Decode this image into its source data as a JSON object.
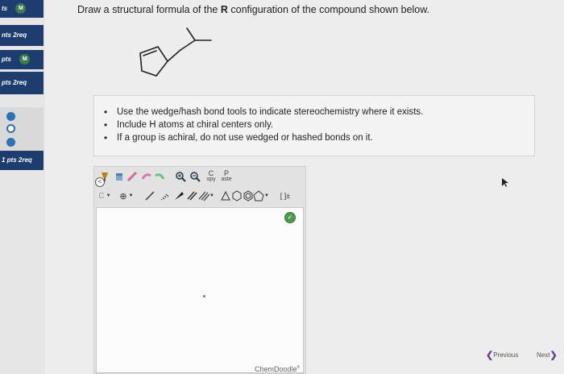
{
  "sidebar": {
    "rows": [
      {
        "label": "ts",
        "badge": "M"
      },
      {
        "label": "nts  2req"
      },
      {
        "label": "pts",
        "badge": "M"
      },
      {
        "label": "pts  2req"
      },
      {
        "label": "1 pts  2req"
      }
    ]
  },
  "question": {
    "prefix": "Draw a structural formula of the ",
    "bold": "R",
    "suffix": " configuration of the compound shown below."
  },
  "instructions": [
    "Use the wedge/hash bond tools to indicate stereochemistry where it exists.",
    "Include H atoms at chiral centers only.",
    "If a group is achiral, do not use wedged or hashed bonds on it."
  ],
  "editor": {
    "copy_label_top": "C",
    "copy_label_bottom": "opy",
    "paste_label_top": "P",
    "paste_label_bottom": "aste",
    "template_button_label": "C",
    "charge_symbol": "⊕",
    "bracket_label": "[ ]±",
    "brand": "ChemDoodle",
    "brand_mark": "®",
    "ok_symbol": "✓"
  },
  "navigation": {
    "previous_label": "Previous",
    "next_label": "Next"
  },
  "colors": {
    "sidebar_dark": "#1d3d6e",
    "badge_green": "#3a7d4a",
    "radio_blue": "#2f6fb5",
    "nav_arrow": "#6a3d9a"
  }
}
